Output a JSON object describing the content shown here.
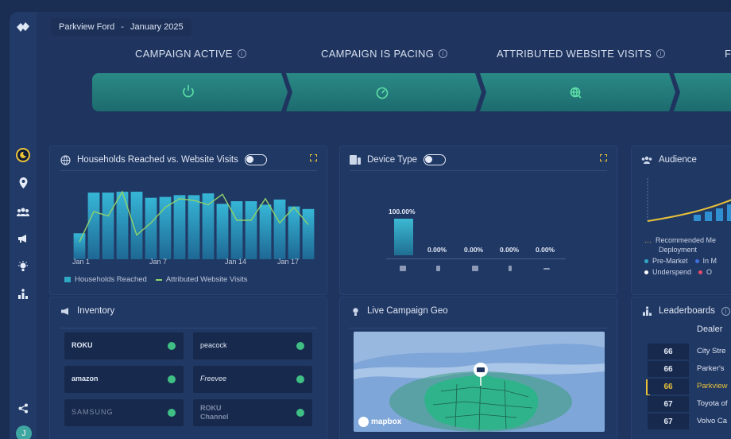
{
  "header": {
    "dealer": "Parkview Ford",
    "separator": "-",
    "period": "January 2025"
  },
  "kpis": [
    {
      "label": "CAMPAIGN ACTIVE",
      "icon": "power-icon"
    },
    {
      "label": "CAMPAIGN IS PACING",
      "icon": "gauge-icon"
    },
    {
      "label": "ATTRIBUTED WEBSITE VISITS",
      "icon": "web-search-icon"
    },
    {
      "label": "F",
      "icon": ""
    }
  ],
  "households": {
    "title": "Households Reached vs. Website Visits",
    "x_ticks": [
      "Jan 1",
      "Jan 7",
      "Jan 14",
      "Jan 17"
    ],
    "legend": [
      "Households Reached",
      "Attributed Website Visits"
    ]
  },
  "device": {
    "title": "Device Type",
    "values": [
      "100.00%",
      "0.00%",
      "0.00%",
      "0.00%",
      "0.00%"
    ]
  },
  "audience": {
    "title": "Audience",
    "legend": [
      "Recommended Me",
      "Deployment",
      "Pre-Market",
      "In M",
      "Underspend",
      "O"
    ]
  },
  "inventory": {
    "title": "Inventory",
    "items": [
      "ROKU",
      "peacock",
      "amazon",
      "Freevee",
      "SAMSUNG",
      "ROKU Channel"
    ]
  },
  "geo": {
    "title": "Live Campaign Geo",
    "attribution": "mapbox"
  },
  "leaderboards": {
    "title": "Leaderboards",
    "column": "Dealer",
    "rows": [
      {
        "rank": "66",
        "name": "City Stre"
      },
      {
        "rank": "66",
        "name": "Parker's"
      },
      {
        "rank": "66",
        "name": "Parkview"
      },
      {
        "rank": "67",
        "name": "Toyota of"
      },
      {
        "rank": "67",
        "name": "Volvo Ca"
      }
    ]
  },
  "chart_data": {
    "type": "bar",
    "categories": [
      "Jan 1",
      "Jan 2",
      "Jan 3",
      "Jan 4",
      "Jan 5",
      "Jan 6",
      "Jan 7",
      "Jan 8",
      "Jan 9",
      "Jan 10",
      "Jan 11",
      "Jan 12",
      "Jan 13",
      "Jan 14",
      "Jan 15",
      "Jan 16",
      "Jan 17"
    ],
    "series": [
      {
        "name": "Households Reached",
        "type": "bar",
        "values": [
          30,
          77,
          77,
          78,
          78,
          71,
          72,
          74,
          74,
          76,
          64,
          67,
          67,
          63,
          69,
          61,
          58
        ]
      },
      {
        "name": "Attributed Website Visits",
        "type": "line",
        "values": [
          20,
          55,
          50,
          78,
          28,
          42,
          60,
          70,
          68,
          63,
          75,
          45,
          45,
          70,
          42,
          60,
          40
        ]
      }
    ],
    "ylim": [
      0,
      90
    ],
    "colors": {
      "bar": "#2fa8c4",
      "line": "#8fd36b"
    }
  }
}
